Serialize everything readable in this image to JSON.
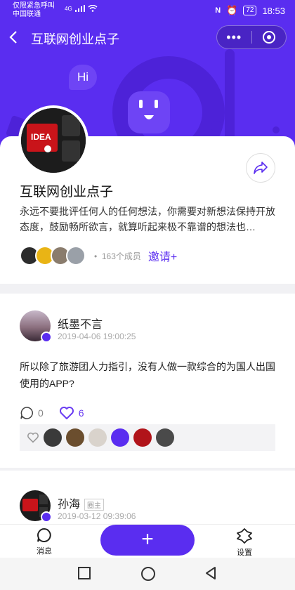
{
  "status_bar": {
    "line1": "仅限紧急呼叫",
    "line2": "中国联通",
    "network": "4G",
    "battery": "72",
    "time": "18:53"
  },
  "nav": {
    "title": "互联网创业点子"
  },
  "hero": {
    "bubble": "Hi"
  },
  "group": {
    "title": "互联网创业点子",
    "description": "永远不要批评任何人的任何想法，你需要对新想法保持开放态度，鼓励畅所欲言，就算听起来极不靠谱的想法也…",
    "member_count": "163个成员",
    "invite_label": "邀请+",
    "avatar_text": "IDEA"
  },
  "posts": [
    {
      "author": "纸墨不言",
      "time": "2019-04-06 19:00:25",
      "text": "所以除了旅游团人力指引，没有人做一款综合的为国人出国使用的APP?",
      "comments": "0",
      "likes": "6"
    },
    {
      "author": "孙海",
      "tag": "圈主",
      "time": "2019-03-12 09:39:06"
    }
  ],
  "tabbar": {
    "messages": "消息",
    "settings": "设置",
    "add": "+"
  },
  "colors": {
    "accent": "#5a2df0",
    "like": "#6a3cf2"
  }
}
